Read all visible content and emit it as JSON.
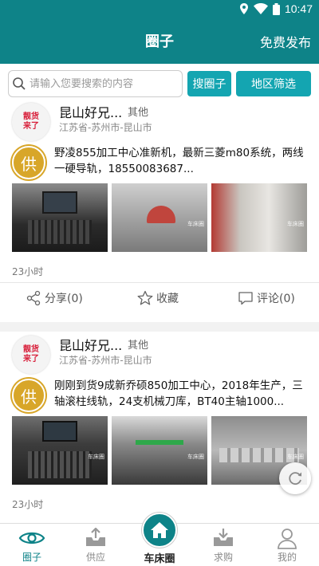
{
  "status_bar": {
    "time": "10:47",
    "icons": [
      "location-icon",
      "wifi-icon",
      "battery-icon"
    ]
  },
  "header": {
    "title": "圈子",
    "publish_label": "免费发布"
  },
  "search": {
    "placeholder": "请输入您要搜索的内容",
    "search_button": "搜圈子",
    "region_button": "地区筛选"
  },
  "posts": [
    {
      "avatar_text": "靓货来了",
      "author": "昆山好兄...",
      "category": "其他",
      "location": "江苏省-苏州市-昆山市",
      "badge": "供",
      "description": "野凌855加工中心准新机，最新三菱m80系统，两线一硬导轨，18550083687...",
      "watermarks": [
        "",
        "车床圈",
        "车床圈"
      ],
      "time_ago": "23小时",
      "share_label": "分享(0)",
      "favorite_label": "收藏",
      "comment_label": "评论(0)"
    },
    {
      "avatar_text": "靓货来了",
      "author": "昆山好兄...",
      "category": "其他",
      "location": "江苏省-苏州市-昆山市",
      "badge": "供",
      "description": "刚刚到货9成新乔硕850加工中心，2018年生产，三轴滚柱线轨，24支机械刀库，BT40主轴1000...",
      "watermarks": [
        "车床圈",
        "车床圈",
        "车床圈"
      ],
      "time_ago": "23小时"
    }
  ],
  "tabs": [
    {
      "label": "圈子",
      "icon": "eye-icon",
      "active": true
    },
    {
      "label": "供应",
      "icon": "upload-tray-icon",
      "active": false
    },
    {
      "label": "车床圈",
      "icon": "home-icon",
      "active": false
    },
    {
      "label": "求购",
      "icon": "download-tray-icon",
      "active": false
    },
    {
      "label": "我的",
      "icon": "user-icon",
      "active": false
    }
  ],
  "colors": {
    "primary": "#0e8388",
    "button": "#14a5b1",
    "badge": "#d8a629",
    "avatar_text": "#d81f3a"
  }
}
